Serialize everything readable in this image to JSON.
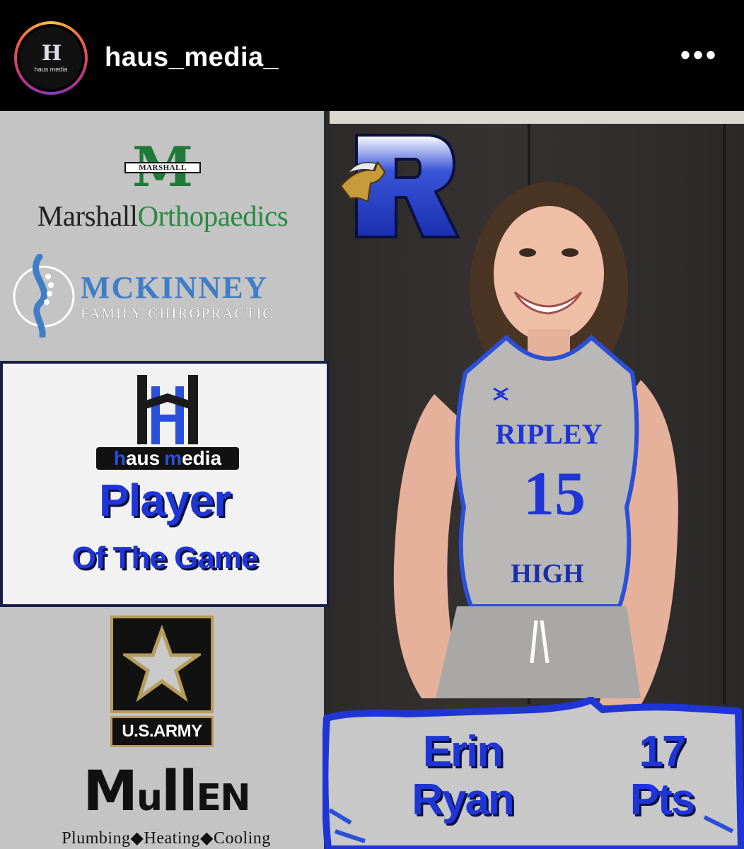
{
  "header": {
    "username": "haus_media_",
    "more_label": "•••",
    "avatar_letter": "H",
    "avatar_text": "haus media"
  },
  "sponsors": {
    "marshall": {
      "band": "MARSHALL",
      "letter": "M",
      "name_part1": "Marshall",
      "name_part2": "Orthopaedics"
    },
    "mckinney": {
      "name": "MCKINNEY",
      "sub": "FAMILY CHIROPRACTIC"
    },
    "army": {
      "label": "U.S.ARMY"
    },
    "mullen": {
      "name_big1": "M",
      "name_rest": "u",
      "name_ll": "ll",
      "name_end": "EN",
      "sub": "Plumbing◆Heating◆Cooling"
    }
  },
  "award": {
    "brand_left": "h",
    "brand_mid": "aus",
    "brand_accent": "m",
    "brand_end": "edia",
    "title": "Player",
    "subtitle": "Of The Game"
  },
  "player": {
    "jersey_top": "RIPLEY",
    "jersey_number": "15",
    "jersey_bottom": "HIGH",
    "first_name": "Erin",
    "last_name": "Ryan",
    "points": "17",
    "points_unit": "Pts"
  },
  "colors": {
    "accent_blue": "#1f35d6",
    "marshall_green": "#2a8a42",
    "army_gold": "#b79b5a",
    "panel_gray": "#c4c4c4"
  }
}
